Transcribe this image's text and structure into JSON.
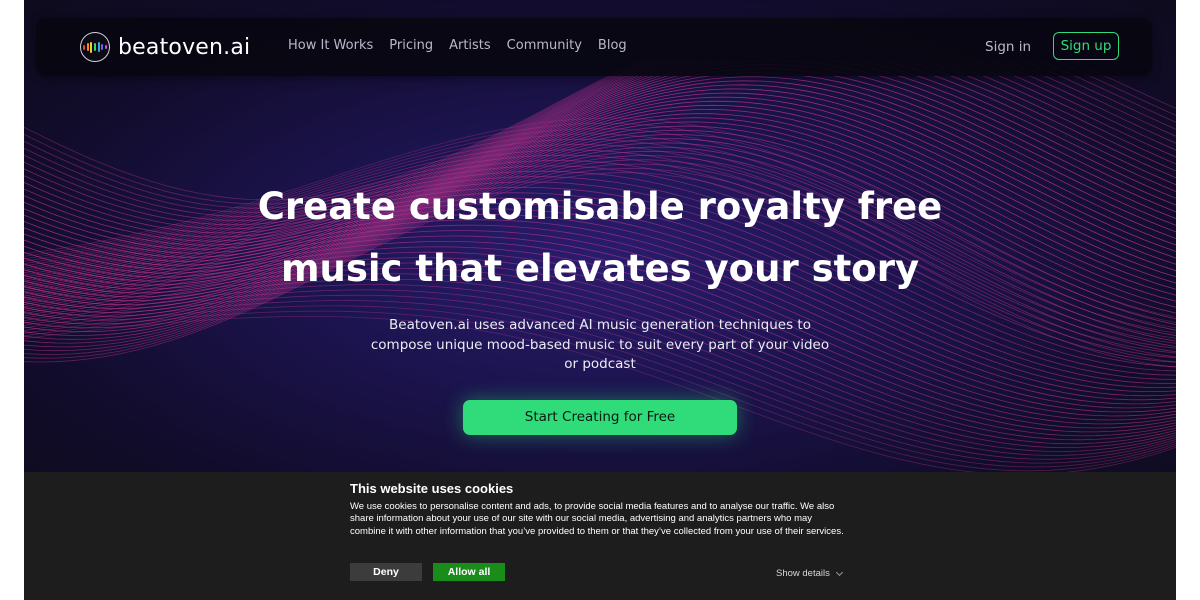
{
  "brand": {
    "name": "beatoven.ai"
  },
  "nav": {
    "links": [
      "How It Works",
      "Pricing",
      "Artists",
      "Community",
      "Blog"
    ],
    "signin": "Sign in",
    "signup": "Sign up"
  },
  "hero": {
    "title_line1": "Create customisable royalty free",
    "title_line2": "music that elevates your story",
    "subtitle": "Beatoven.ai uses advanced AI music generation techniques to compose unique mood-based music to suit every part of your video or podcast",
    "cta": "Start Creating for Free"
  },
  "cookie": {
    "title": "This website uses cookies",
    "body": "We use cookies to personalise content and ads, to provide social media features and to analyse our traffic. We also share information about your use of our site with our social media, advertising and analytics partners who may combine it with other information that you’ve provided to them or that they’ve collected from your use of their services.",
    "deny": "Deny",
    "allow": "Allow all",
    "details": "Show details"
  },
  "colors": {
    "accent_green": "#2fdc79",
    "hero_bg": "#140f26",
    "wave_magenta": "#c4368f",
    "cookie_bg": "#1d1d1d",
    "allow_green": "#1a8c1a",
    "deny_gray": "#3c3c3c"
  },
  "icons": {
    "logo": "equalizer-bars-icon",
    "details_chevron": "chevron-down-icon"
  }
}
